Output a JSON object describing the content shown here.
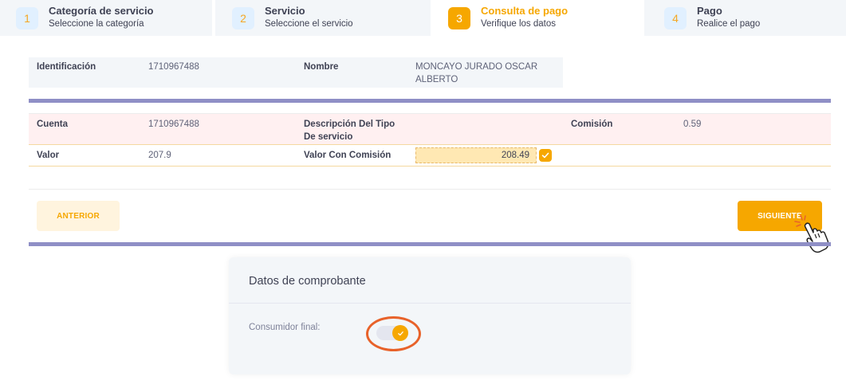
{
  "steps": [
    {
      "number": "1",
      "title": "Categoría de servicio",
      "subtitle": "Seleccione la categoría"
    },
    {
      "number": "2",
      "title": "Servicio",
      "subtitle": "Seleccione el servicio"
    },
    {
      "number": "3",
      "title": "Consulta de pago",
      "subtitle": "Verifique los datos"
    },
    {
      "number": "4",
      "title": "Pago",
      "subtitle": "Realice el pago"
    }
  ],
  "customer": {
    "id_label": "Identificación",
    "id_value": "1710967488",
    "name_label": "Nombre",
    "name_line1": "MONCAYO JURADO OSCAR",
    "name_line2": "ALBERTO"
  },
  "payment": {
    "account_label": "Cuenta",
    "account_value": "1710967488",
    "desc_label_line1": "Descripción Del Tipo",
    "desc_label_line2": "De servicio",
    "commission_label": "Comisión",
    "commission_value": "0.59",
    "value_label": "Valor",
    "value_value": "207.9",
    "total_label": "Valor Con Comisión",
    "total_value": "208.49"
  },
  "buttons": {
    "prev": "ANTERIOR",
    "next": "SIGUIENTE"
  },
  "voucher": {
    "title": "Datos de comprobante",
    "final_consumer_label": "Consumidor final:",
    "final_consumer_on": true
  },
  "colors": {
    "accent": "#f6a700",
    "divider": "#8f8fc6",
    "highlight": "#e8622a"
  }
}
